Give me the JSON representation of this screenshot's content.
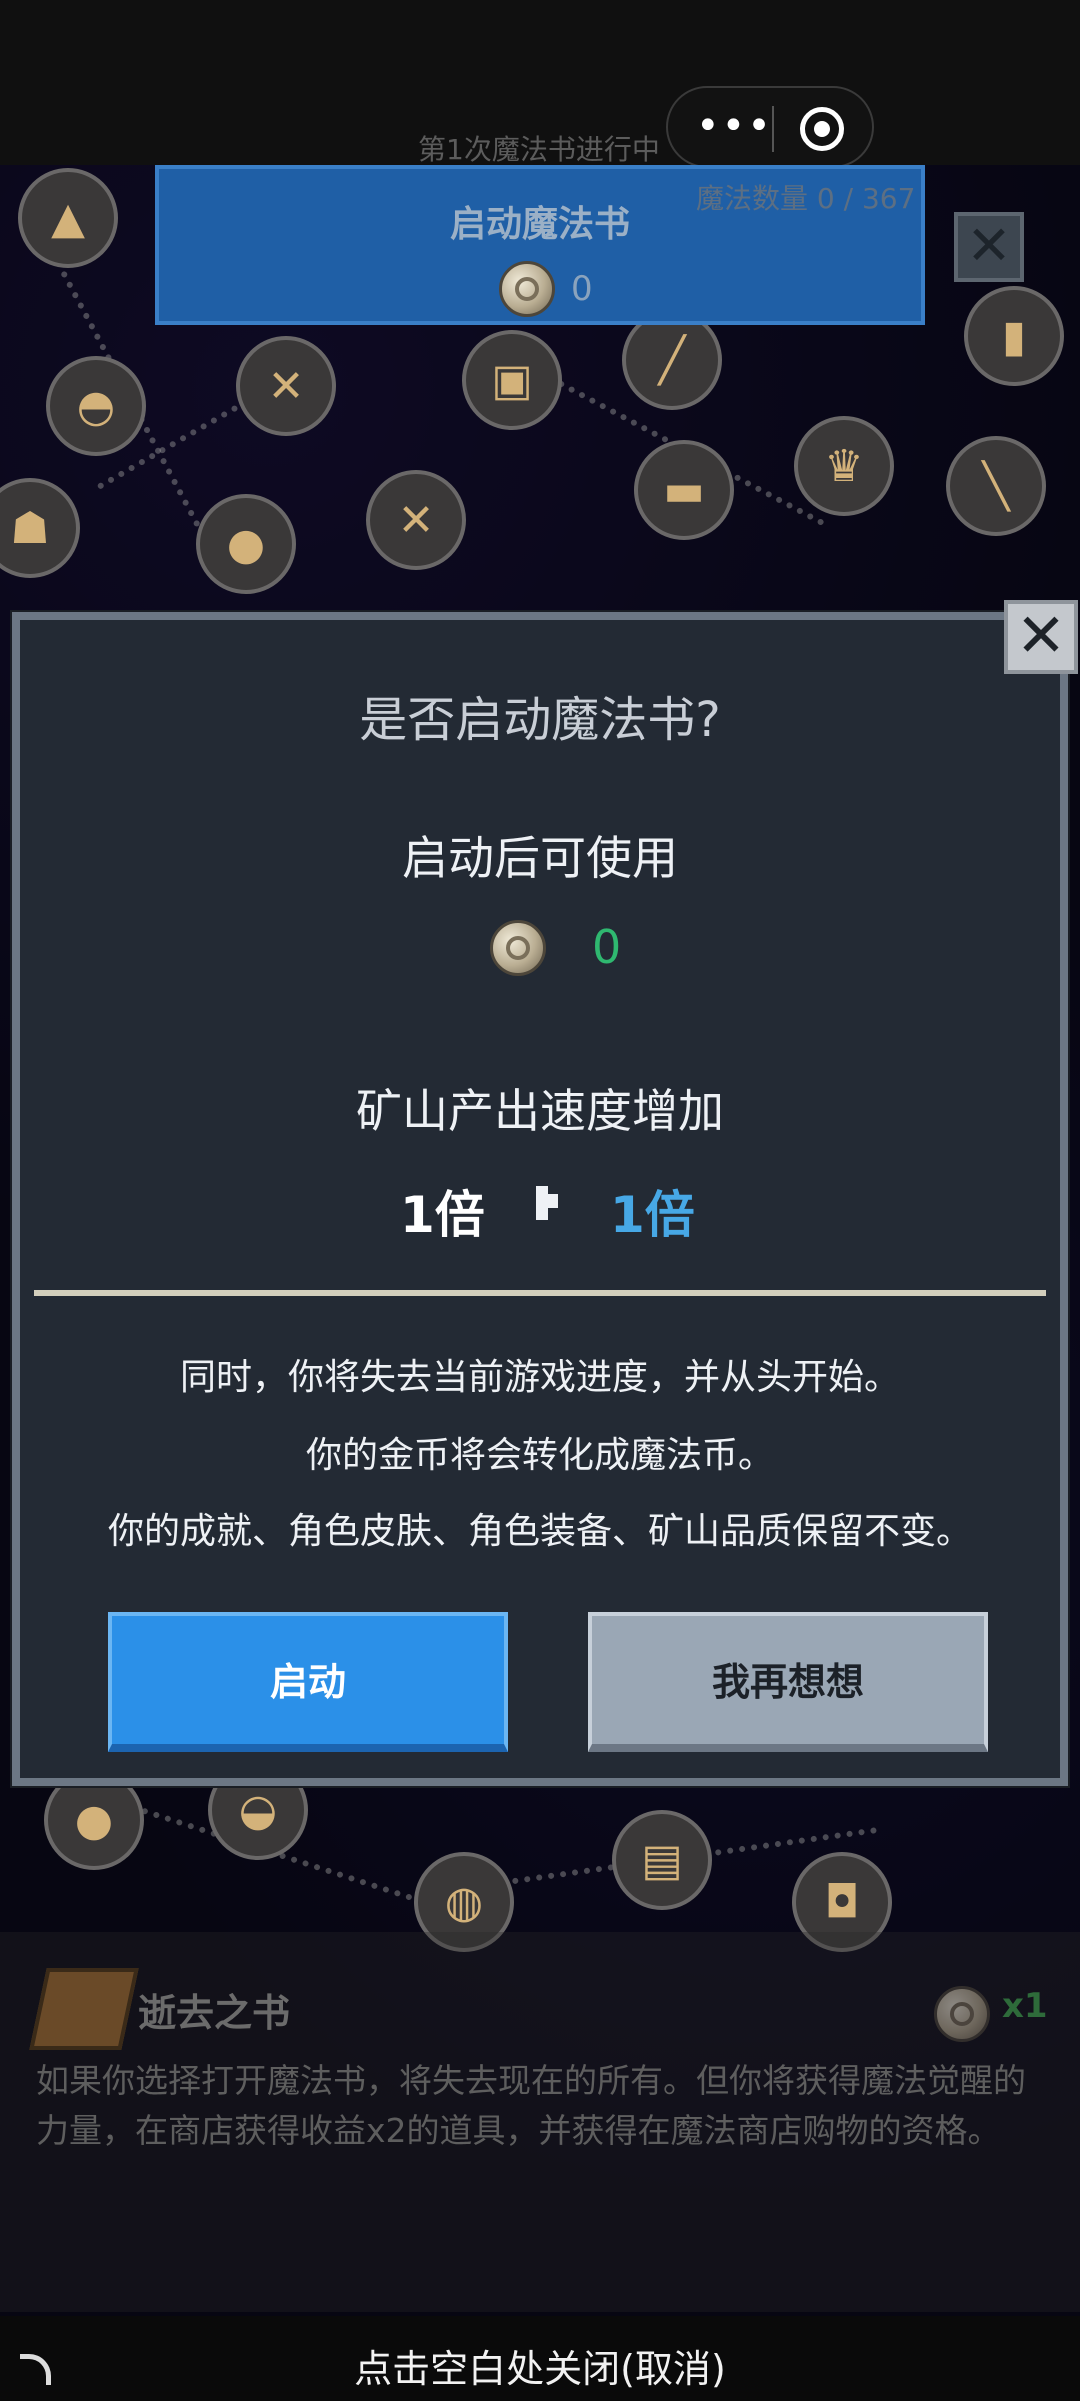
{
  "header": {
    "progress_label": "第1次魔法书进行中",
    "menu_icon": "more-dots-icon",
    "target_icon": "target-circle-icon"
  },
  "start_panel": {
    "title": "启动魔法书",
    "coin_value": "0",
    "magic_count": "魔法数量 0 / 367"
  },
  "dialog": {
    "title": "是否启动魔法书?",
    "after_label": "启动后可使用",
    "coin_value": "0",
    "speed_label": "矿山产出速度增加",
    "speed_from": "1倍",
    "speed_to": "1倍",
    "info_lines": [
      "同时，你将失去当前游戏进度，并从头开始。",
      "你的金币将会转化成魔法币。",
      "你的成就、角色皮肤、角色装备、矿山品质保留不变。"
    ],
    "confirm_label": "启动",
    "cancel_label": "我再想想"
  },
  "book": {
    "title": "逝去之书",
    "multiplier": "x1",
    "description": "如果你选择打开魔法书，将失去现在的所有。但你将获得魔法觉醒的力量，在商店获得收益x2的道具，并获得在魔法商店购物的资格。"
  },
  "footer": {
    "hint": "点击空白处关闭(取消)"
  },
  "colors": {
    "primary_button": "#2b90e8",
    "secondary_button": "#9aa7b5",
    "dialog_bg": "#232a34",
    "coin_value": "#2fb870",
    "speed_target": "#47a8e6"
  },
  "background_items": [
    "mine-icon",
    "sword-icon",
    "chest-icon",
    "skewer-icon",
    "beer-icon",
    "helmet-icon",
    "monster-icon",
    "slime-icon",
    "meat-icon",
    "crown-cake-icon",
    "wine-icon",
    "onion-icon",
    "garlic-icon",
    "pot-icon",
    "scroll-icon",
    "cookie-icon"
  ]
}
